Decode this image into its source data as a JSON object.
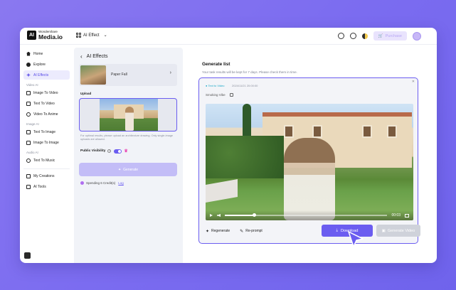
{
  "brand": {
    "small": "Wondershare",
    "big": "Media.io",
    "mark": "AI"
  },
  "header": {
    "breadcrumb": "AI Effect",
    "purchase": "Purchase"
  },
  "sidebar": {
    "items": [
      {
        "label": "Home",
        "icon": "home-icon"
      },
      {
        "label": "Explore",
        "icon": "compass-icon"
      },
      {
        "label": "AI Effects",
        "icon": "sparkle-icon",
        "active": true
      }
    ],
    "sections": [
      {
        "title": "Video AI",
        "items": [
          "Image To Video",
          "Text To Video",
          "Video To Anime"
        ]
      },
      {
        "title": "Image AI",
        "items": [
          "Text To Image",
          "Image To Image"
        ]
      },
      {
        "title": "Audio AI",
        "items": [
          "Text To Music"
        ]
      }
    ],
    "bottom": [
      "My Creations",
      "AI Tools"
    ]
  },
  "panel": {
    "title": "AI Effects",
    "effect_name": "Paper Fall",
    "upload_label": "Upload",
    "tip": "For optimal results, please upload an architecture drawing. Only single-image uploads are allowed.",
    "visibility_label": "Public Visibility",
    "generate_label": "Generate",
    "credits_label": "Spending 6 Credit(s)",
    "credits_link": "Log"
  },
  "generate_list": {
    "title": "Generate list",
    "subtitle": "Your task results will be kept for 7 days. Please check them in time.",
    "card": {
      "tag": "Text to Video",
      "time": "2024/11/21 20:00:00",
      "prompt": "Smoking Vibe",
      "video_time": "00:03",
      "progress": 0.18,
      "regenerate": "Regenerate",
      "reprompt": "Re-prompt",
      "download": "Download",
      "generate_video": "Generate Video"
    }
  },
  "colors": {
    "accent": "#6b5df0",
    "background": "#7b6cf0",
    "tag": "#1aa8c7"
  }
}
